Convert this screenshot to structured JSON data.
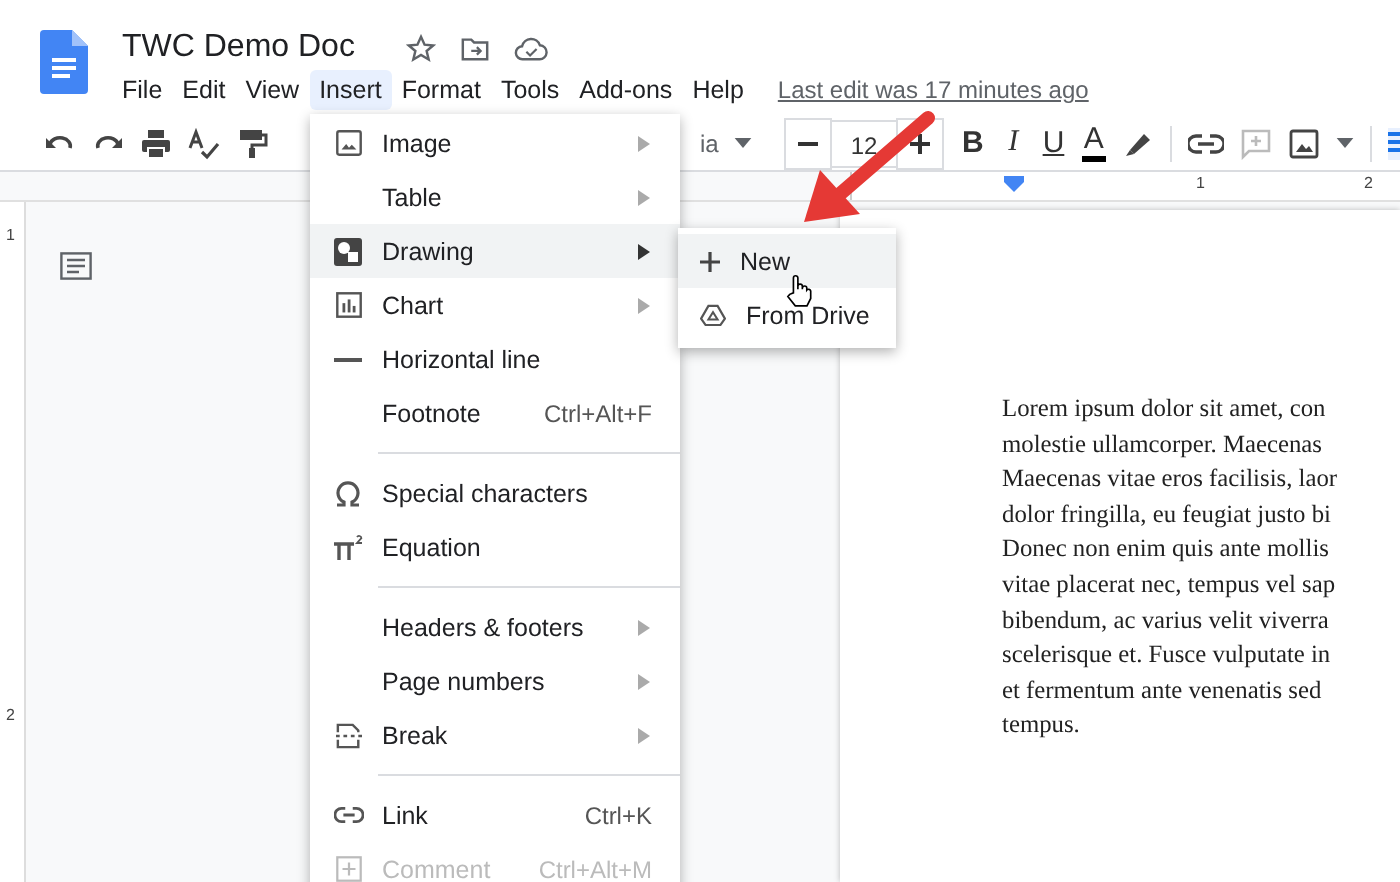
{
  "document": {
    "title": "TWC Demo Doc"
  },
  "menu_bar": [
    {
      "label": "File",
      "selected": false
    },
    {
      "label": "Edit",
      "selected": false
    },
    {
      "label": "View",
      "selected": false
    },
    {
      "label": "Insert",
      "selected": true
    },
    {
      "label": "Format",
      "selected": false
    },
    {
      "label": "Tools",
      "selected": false
    },
    {
      "label": "Add-ons",
      "selected": false
    },
    {
      "label": "Help",
      "selected": false
    }
  ],
  "last_edit": "Last edit was 17 minutes ago",
  "toolbar": {
    "font_name": "ia",
    "font_size": "12",
    "format_letters": [
      "B",
      "I",
      "U",
      "A"
    ]
  },
  "ruler": {
    "horizontal_marks": [
      "1",
      "2"
    ],
    "vertical_marks": [
      "1",
      "2"
    ]
  },
  "insert_menu": [
    {
      "kind": "item",
      "label": "Image",
      "has_submenu": true,
      "selected": false,
      "disabled": false
    },
    {
      "kind": "item",
      "label": "Table",
      "has_submenu": true,
      "selected": false,
      "disabled": false
    },
    {
      "kind": "item",
      "label": "Drawing",
      "has_submenu": true,
      "selected": true,
      "disabled": false
    },
    {
      "kind": "item",
      "label": "Chart",
      "has_submenu": true,
      "selected": false,
      "disabled": false
    },
    {
      "kind": "item",
      "label": "Horizontal line",
      "has_submenu": false,
      "selected": false,
      "disabled": false
    },
    {
      "kind": "item",
      "label": "Footnote",
      "shortcut": "Ctrl+Alt+F",
      "has_submenu": false,
      "selected": false,
      "disabled": false
    },
    {
      "kind": "separator"
    },
    {
      "kind": "item",
      "label": "Special characters",
      "has_submenu": false,
      "selected": false,
      "disabled": false
    },
    {
      "kind": "item",
      "label": "Equation",
      "has_submenu": false,
      "selected": false,
      "disabled": false
    },
    {
      "kind": "separator"
    },
    {
      "kind": "item",
      "label": "Headers & footers",
      "has_submenu": true,
      "selected": false,
      "disabled": false
    },
    {
      "kind": "item",
      "label": "Page numbers",
      "has_submenu": true,
      "selected": false,
      "disabled": false
    },
    {
      "kind": "item",
      "label": "Break",
      "has_submenu": true,
      "selected": false,
      "disabled": false
    },
    {
      "kind": "separator"
    },
    {
      "kind": "item",
      "label": "Link",
      "shortcut": "Ctrl+K",
      "has_submenu": false,
      "selected": false,
      "disabled": false
    },
    {
      "kind": "item",
      "label": "Comment",
      "shortcut": "Ctrl+Alt+M",
      "has_submenu": false,
      "selected": false,
      "disabled": true
    }
  ],
  "drawing_submenu": [
    {
      "label": "New",
      "selected": true
    },
    {
      "label": "From Drive",
      "selected": false
    }
  ],
  "page_lines": [
    "Lorem ipsum dolor sit amet, con",
    "molestie ullamcorper. Maecenas",
    "Maecenas vitae eros facilisis, laor",
    "dolor fringilla, eu feugiat justo bi",
    "Donec non enim quis ante mollis",
    "vitae placerat nec, tempus vel sap",
    "bibendum, ac varius velit viverra",
    "scelerisque et. Fusce vulputate in",
    "et fermentum ante venenatis sed",
    "tempus."
  ]
}
